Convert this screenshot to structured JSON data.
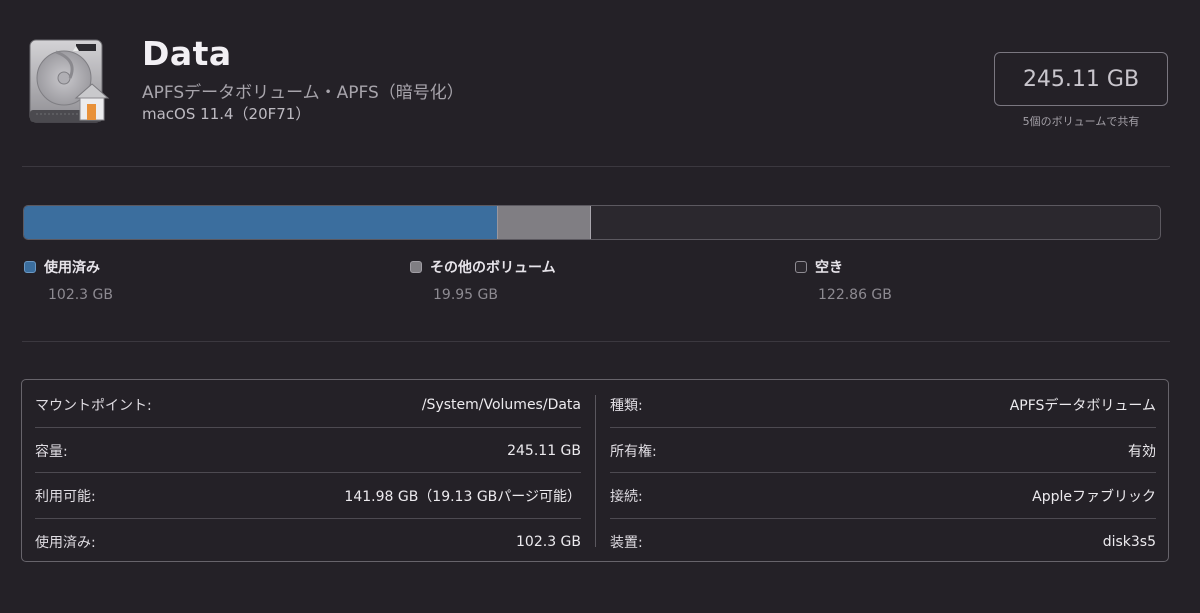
{
  "header": {
    "title": "Data",
    "subtitle": "APFSデータボリューム・APFS（暗号化）",
    "os_version": "macOS 11.4（20F71）",
    "capacity": "245.11 GB",
    "capacity_note": "5個のボリュームで共有",
    "icon": "internal-hard-drive-home-icon"
  },
  "usage": {
    "total_gb": 245.11,
    "segments": [
      {
        "label": "使用済み",
        "value": "102.3 GB",
        "gb": 102.3,
        "color": "#3b6e9e"
      },
      {
        "label": "その他のボリューム",
        "value": "19.95 GB",
        "gb": 19.95,
        "color": "#807e83"
      },
      {
        "label": "空き",
        "value": "122.86 GB",
        "gb": 122.86,
        "color": "#2b282e"
      }
    ]
  },
  "info": {
    "left": [
      {
        "label": "マウントポイント:",
        "value": "/System/Volumes/Data"
      },
      {
        "label": "容量:",
        "value": "245.11 GB"
      },
      {
        "label": "利用可能:",
        "value": "141.98 GB（19.13 GBパージ可能）"
      },
      {
        "label": "使用済み:",
        "value": "102.3 GB"
      }
    ],
    "right": [
      {
        "label": "種類:",
        "value": "APFSデータボリューム"
      },
      {
        "label": "所有権:",
        "value": "有効"
      },
      {
        "label": "接続:",
        "value": "Appleファブリック"
      },
      {
        "label": "装置:",
        "value": "disk3s5"
      }
    ]
  }
}
